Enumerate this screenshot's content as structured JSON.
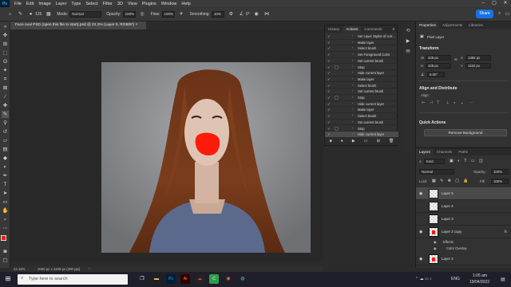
{
  "menu": {
    "app_logo": "Ps",
    "items": [
      "File",
      "Edit",
      "Image",
      "Layer",
      "Type",
      "Select",
      "Filter",
      "3D",
      "View",
      "Plugins",
      "Window",
      "Help"
    ]
  },
  "options_bar": {
    "brush_size": "125",
    "mode_label": "Mode:",
    "mode_value": "Normal",
    "opacity_label": "Opacity:",
    "opacity_value": "100%",
    "flow_label": "Flow:",
    "flow_value": "100%",
    "smoothing_label": "Smoothing:",
    "smoothing_value": "10%",
    "angle_value": "0°",
    "share_label": "Share"
  },
  "document": {
    "tab_title": "Face oval PSD (open this file to start).psd @ 22.2% (Layer 5, RGB/8*) ×",
    "zoom": "22.18%",
    "dimensions": "2060 px x 2208 px (300 ppi)"
  },
  "actions_panel": {
    "tabs": [
      "History",
      "Actions",
      "Comments"
    ],
    "rows": [
      {
        "text": "Set Layer Styles of curr...",
        "has_cell": false,
        "selected": false
      },
      {
        "text": "Make layer",
        "has_cell": false,
        "selected": false
      },
      {
        "text": "Select brush",
        "has_cell": false,
        "selected": false
      },
      {
        "text": "Set Foreground Color",
        "has_cell": false,
        "selected": false
      },
      {
        "text": "Set current brush",
        "has_cell": false,
        "selected": false
      },
      {
        "text": "Stop",
        "has_cell": true,
        "selected": false
      },
      {
        "text": "Hide current layer",
        "has_cell": false,
        "selected": false
      },
      {
        "text": "Make layer",
        "has_cell": false,
        "selected": false
      },
      {
        "text": "Select brush",
        "has_cell": false,
        "selected": false
      },
      {
        "text": "Set current brush",
        "has_cell": false,
        "selected": false
      },
      {
        "text": "Stop",
        "has_cell": true,
        "selected": false
      },
      {
        "text": "Hide current layer",
        "has_cell": false,
        "selected": false
      },
      {
        "text": "Make layer",
        "has_cell": false,
        "selected": false
      },
      {
        "text": "Select brush",
        "has_cell": false,
        "selected": false
      },
      {
        "text": "Set current brush",
        "has_cell": false,
        "selected": false
      },
      {
        "text": "Stop",
        "has_cell": true,
        "selected": false
      },
      {
        "text": "Hide current layer",
        "has_cell": false,
        "selected": true
      }
    ]
  },
  "properties": {
    "tabs": [
      "Properties",
      "Adjustments",
      "Libraries"
    ],
    "layer_kind": "Pixel Layer",
    "transform_title": "Transform",
    "w_label": "W",
    "w_value": "428 px",
    "h_label": "H",
    "h_value": "428 px",
    "x_label": "X",
    "x_value": "1392 px",
    "y_label": "Y",
    "y_value": "1162 px",
    "angle_value": "0.00°",
    "align_title": "Align and Distribute",
    "align_sub": "Align:",
    "quick_actions_title": "Quick Actions",
    "remove_bg_label": "Remove Background"
  },
  "layers_panel": {
    "tabs": [
      "Layers",
      "Channels",
      "Paths"
    ],
    "kind_label": "Kind",
    "blend_mode": "Normal",
    "opacity_label": "Opacity:",
    "opacity_value": "100%",
    "lock_label": "Lock:",
    "fill_label": "Fill:",
    "fill_value": "100%",
    "layers": [
      {
        "name": "Layer 5",
        "visible": true,
        "selected": true,
        "fx": ""
      },
      {
        "name": "Layer 4",
        "visible": false,
        "selected": false,
        "fx": ""
      },
      {
        "name": "Layer 3",
        "visible": false,
        "selected": false,
        "fx": ""
      },
      {
        "name": "Layer 2 copy",
        "visible": true,
        "selected": false,
        "fx": "fx"
      },
      {
        "name": "Layer 2",
        "visible": true,
        "selected": false,
        "fx": ""
      }
    ],
    "effects_label": "Effects",
    "color_overlay_label": "Color Overlay"
  },
  "taskbar": {
    "search_placeholder": "Type here to search",
    "time": "1:05 am",
    "date": "19/04/2022",
    "language": "ENG"
  },
  "colors": {
    "accent": "#1473e6",
    "ps_logo": "#31a8ff",
    "paint_red": "#ff1a0a"
  }
}
